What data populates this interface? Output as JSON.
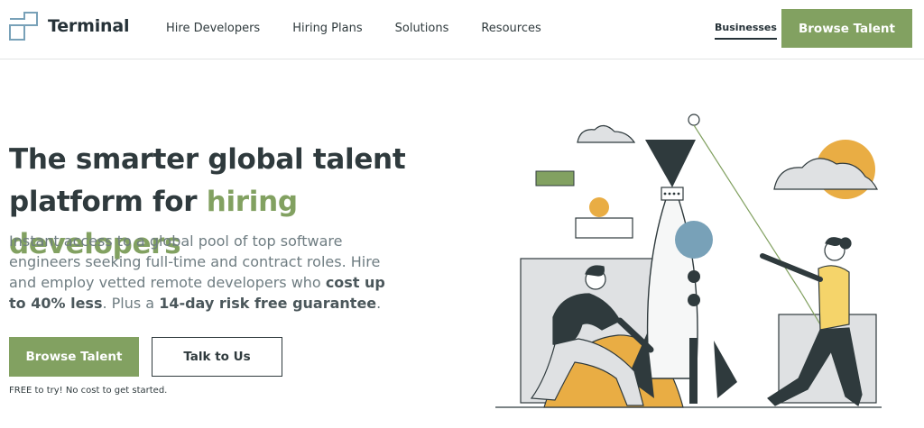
{
  "brand": {
    "name": "Terminal"
  },
  "nav": {
    "items": [
      {
        "label": "Hire Developers"
      },
      {
        "label": "Hiring Plans"
      },
      {
        "label": "Solutions"
      },
      {
        "label": "Resources"
      }
    ],
    "businesses_label": "Businesses",
    "cta_label": "Browse Talent"
  },
  "hero": {
    "title_line1": "The smarter global talent",
    "title_line2_prefix": "platform for ",
    "title_line2_accent": "hiring developers",
    "desc_part1": "Instant access to a global pool of top software engineers seeking full-time and contract roles. Hire and employ vetted remote developers who ",
    "desc_bold1": "cost up to 40% less",
    "desc_part2": ". Plus a ",
    "desc_bold2": "14-day risk free guarantee",
    "desc_part3": ".",
    "primary_button": "Browse Talent",
    "secondary_button": "Talk to Us",
    "note": "FREE to try! No cost to get started."
  },
  "colors": {
    "accent": "#82a161",
    "dark": "#263238",
    "muted_text": "#6f7d82",
    "yellow": "#f5d46a",
    "orange": "#e9ad44",
    "blue": "#78a1b8",
    "gray": "#dfe1e3"
  }
}
